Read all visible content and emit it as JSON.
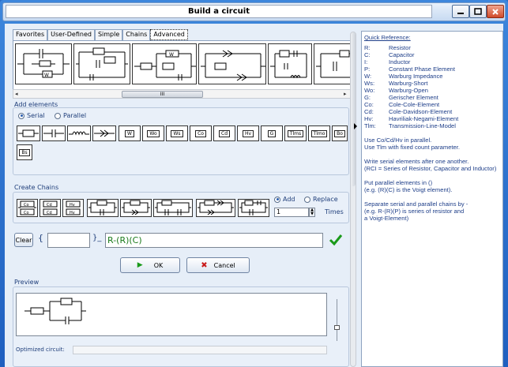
{
  "window": {
    "title": "Build a circuit"
  },
  "tabs": [
    "Favorites",
    "User-Defined",
    "Simple",
    "Chains",
    "Advanced"
  ],
  "add_elements": {
    "title": "Add elements",
    "serial_label": "Serial",
    "parallel_label": "Parallel",
    "selected_mode": "Serial",
    "element_buttons": [
      "W",
      "Wo",
      "Ws",
      "Co",
      "Cd",
      "Hv",
      "G",
      "Tlms",
      "Tlmo",
      "Bo",
      "Bs"
    ]
  },
  "create_chains": {
    "title": "Create Chains",
    "chain_labels": [
      [
        "Co",
        "Co"
      ],
      [
        "Cd",
        "Cd"
      ],
      [
        "Hv",
        "Hv"
      ]
    ],
    "add_label": "Add",
    "replace_label": "Replace",
    "selected_action": "Add",
    "times_value": "1",
    "times_label": "Times"
  },
  "expression": {
    "clear_label": "Clear",
    "open_brace": "{",
    "close_brace": "}_",
    "prefix_value": "",
    "circuit_value": "R-(R)(C)"
  },
  "actions": {
    "ok_label": "OK",
    "cancel_label": "Cancel"
  },
  "preview": {
    "title": "Preview",
    "optimized_label": "Optimized circuit:",
    "optimized_value": ""
  },
  "scrollbar": {
    "thumb_label": "III"
  },
  "reference": {
    "title": "Quick Reference:",
    "entries": [
      {
        "k": "R:",
        "v": "Resistor"
      },
      {
        "k": "C:",
        "v": "Capacitor"
      },
      {
        "k": "I:",
        "v": "Inductor"
      },
      {
        "k": "P:",
        "v": "Constant Phase Element"
      },
      {
        "k": "W:",
        "v": "Warburg Impedance"
      },
      {
        "k": "Ws:",
        "v": "Warburg-Short"
      },
      {
        "k": "Wo:",
        "v": "Warburg-Open"
      },
      {
        "k": "G:",
        "v": "Gerischer Element"
      },
      {
        "k": "Co:",
        "v": "Cole-Cole-Element"
      },
      {
        "k": "Cd:",
        "v": "Cole-Davidson-Element"
      },
      {
        "k": "Hv:",
        "v": "Havriliak-Negami-Element"
      },
      {
        "k": "Tlm:",
        "v": "Transmission-Line-Model"
      }
    ],
    "notes": [
      "Use Co/Cd/Hv in parallel.",
      "Use Tlm with fixed count parameter.",
      "Write serial elements after one another.",
      "(RCI = Series of Resistor, Capacitor and Inductor)",
      "Put parallel elements in ()",
      "(e.g. (R)(C) is the Voigt element).",
      "Separate serial and parallel chains by -",
      "(e.g. R-(R)(P) is series of resistor and",
      "a Voigt-Element)"
    ]
  },
  "colors": {
    "accent": "#1f3e7a",
    "valid": "#1a9a1a"
  }
}
